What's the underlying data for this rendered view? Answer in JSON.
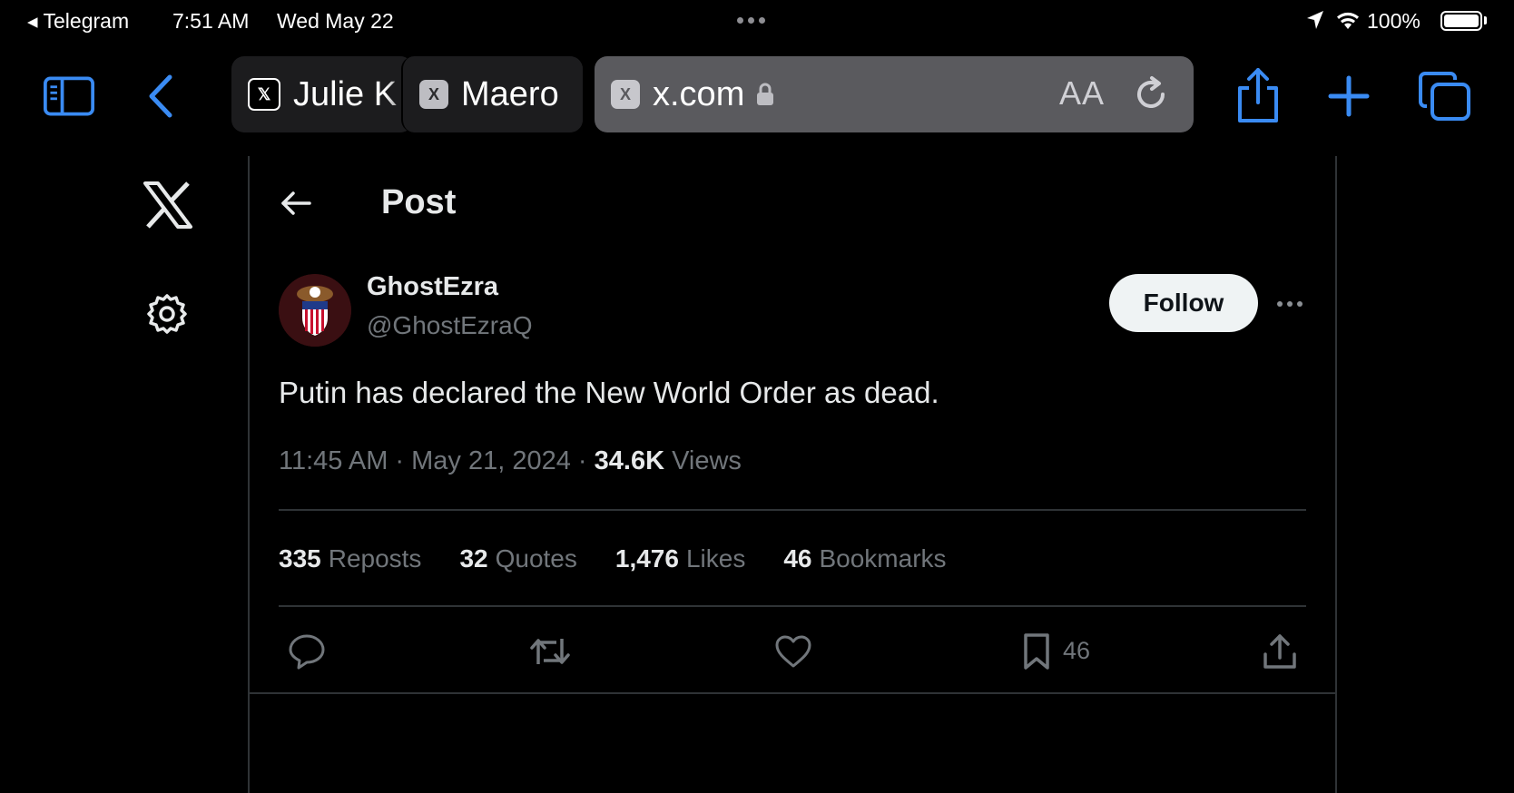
{
  "status_bar": {
    "back_app": "◂ Telegram",
    "time": "7:51 AM",
    "date": "Wed May 22",
    "battery": "100%"
  },
  "tabs": [
    {
      "favicon": "x-logo-icon",
      "title": "Julie K"
    },
    {
      "favicon": "x-logo-icon",
      "title": "Maero"
    },
    {
      "favicon": "x-logo-icon",
      "title": "x.com"
    }
  ],
  "address_bar": {
    "text_size_label": "AA"
  },
  "page": {
    "title": "Post",
    "author": {
      "name": "GhostEzra",
      "handle": "@GhostEzraQ"
    },
    "follow_label": "Follow",
    "tweet_text": "Putin has declared the New World Order as dead.",
    "timestamp": "11:45 AM · May 21, 2024 · ",
    "views_count": "34.6K",
    "views_label": " Views",
    "stats": [
      {
        "count": "335",
        "label": "Reposts"
      },
      {
        "count": "32",
        "label": "Quotes"
      },
      {
        "count": "1,476",
        "label": "Likes"
      },
      {
        "count": "46",
        "label": "Bookmarks"
      }
    ],
    "bookmark_count": "46"
  },
  "colors": {
    "accent": "#3a8bf3",
    "background": "#000000",
    "divider": "#2f3336",
    "muted": "#71767b"
  }
}
